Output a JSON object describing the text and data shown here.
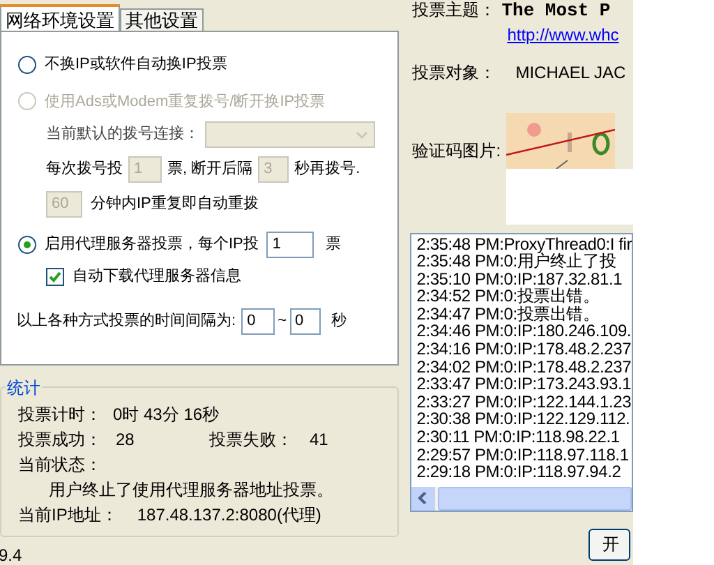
{
  "tabs": [
    {
      "label": "网络环境设置",
      "selected": true
    },
    {
      "label": "其他设置",
      "selected": false
    }
  ],
  "no_change": {
    "label": "不换IP或软件自动换IP投票",
    "selected": false,
    "disabled": false
  },
  "dialup": {
    "label": "使用Ads或Modem重复拨号/断开换IP投票",
    "selected": false,
    "disabled": true,
    "connection_label": "当前默认的拨号连接：",
    "votes_prefix": "每次拨号投",
    "votes_value": "1",
    "votes_suffix": "票, 断开后隔",
    "wait_value": "3",
    "wait_suffix": "秒再拨号.",
    "minutes_value": "60",
    "minutes_suffix": "分钟内IP重复即自动重拨"
  },
  "proxy": {
    "label": "启用代理服务器投票，每个IP投",
    "selected": true,
    "disabled": false,
    "votes_value": "1",
    "votes_suffix": "票",
    "auto_download": {
      "label": "自动下载代理服务器信息",
      "checked": true
    }
  },
  "interval": {
    "label": "以上各种方式投票的时间间隔为:",
    "min": "0",
    "separator": "~",
    "max": "0",
    "unit": "秒"
  },
  "stats": {
    "title": "统计",
    "timer_label": "投票计时：",
    "timer_value": "0时 43分 16秒",
    "success_label": "投票成功：",
    "success_value": "28",
    "fail_label": "投票失败：",
    "fail_value": "41",
    "status_label": "当前状态：",
    "status_value": "用户终止了使用代理服务器地址投票。",
    "ip_label": "当前IP地址：",
    "ip_value": "187.48.137.2:8080(代理)"
  },
  "version": "9.4",
  "vote": {
    "subject_label": "投票主题：",
    "subject": "The Most P",
    "link": "http://www.whc",
    "target_label": "投票对象：",
    "target": "MICHAEL JAC",
    "captcha_label": "验证码图片:"
  },
  "log": [
    "2:35:48 PM:ProxyThread0:I fir",
    "2:35:48 PM:0:用户终止了投",
    "2:35:10 PM:0:IP:187.32.81.1",
    "2:34:52 PM:0:投票出错。",
    "2:34:47 PM:0:投票出错。",
    "2:34:46 PM:0:IP:180.246.109.",
    "2:34:16 PM:0:IP:178.48.2.237",
    "2:34:02 PM:0:IP:178.48.2.237",
    "2:33:47 PM:0:IP:173.243.93.1",
    "2:33:27 PM:0:IP:122.144.1.23",
    "2:30:38 PM:0:IP:122.129.112.",
    "2:30:11 PM:0:IP:118.98.22.1",
    "2:29:57 PM:0:IP:118.97.118.1",
    "2:29:18 PM:0:IP:118.97.94.2"
  ],
  "start_button": "开"
}
